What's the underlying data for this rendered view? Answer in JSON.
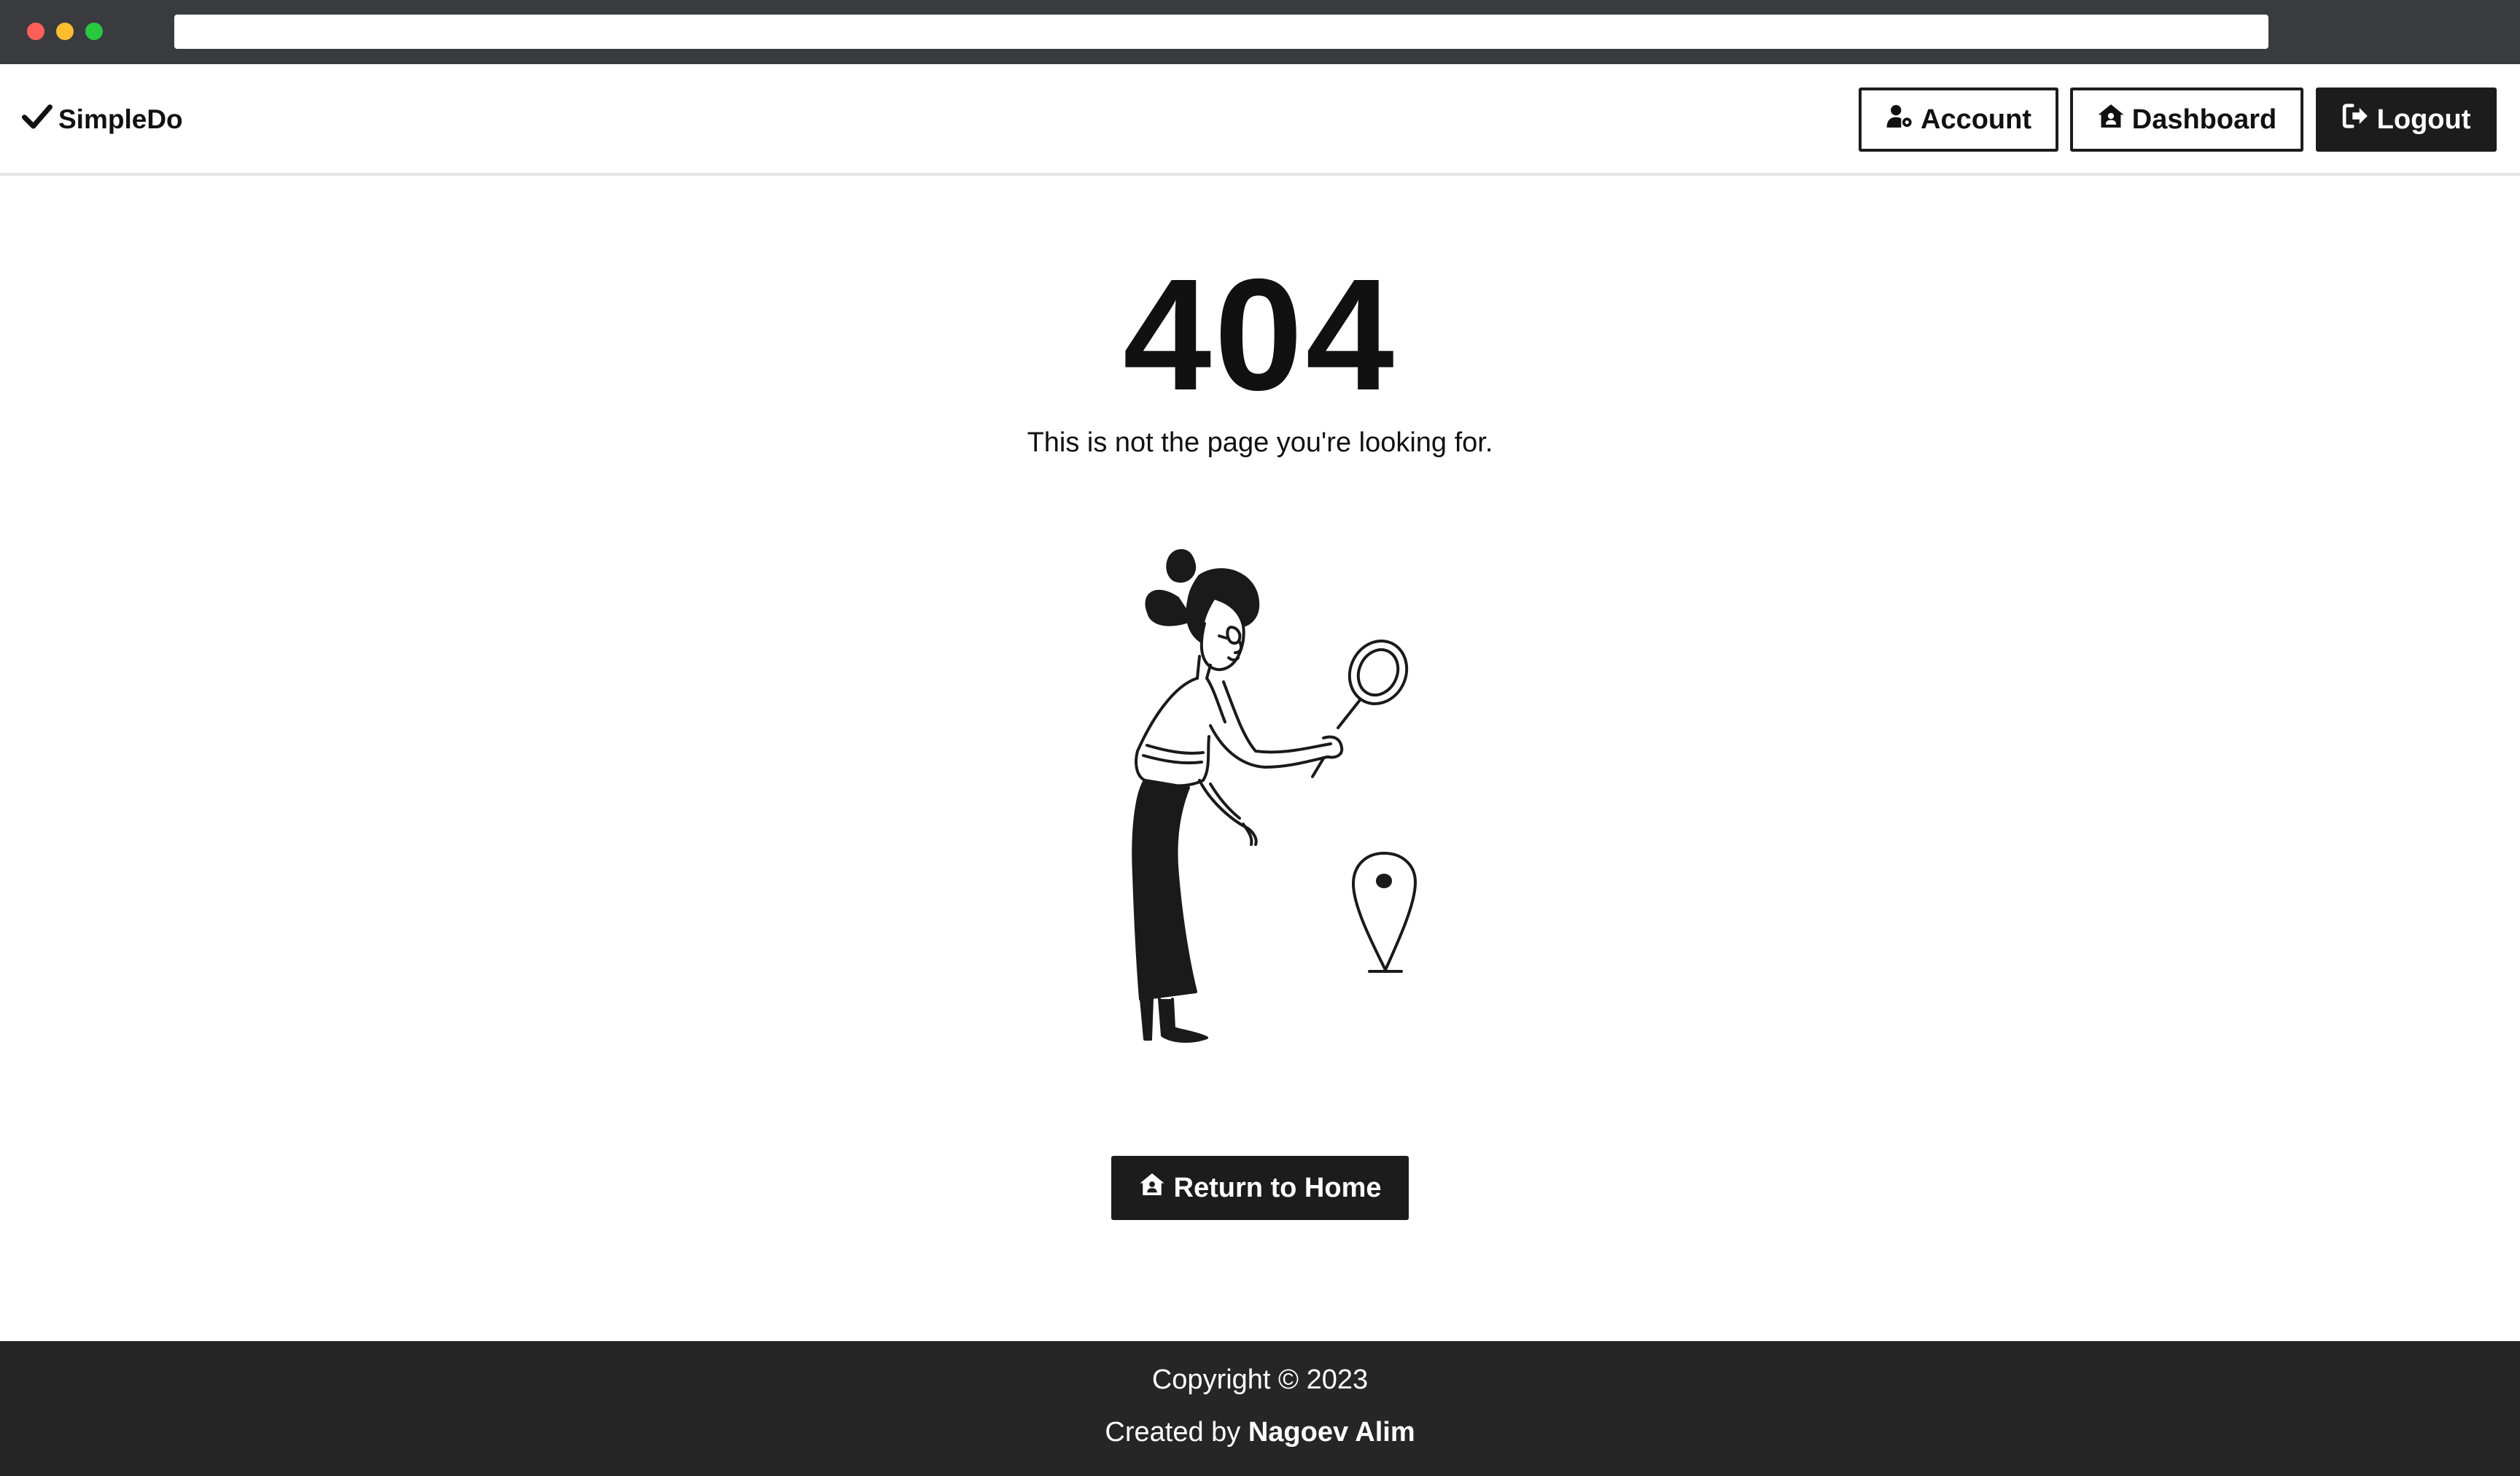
{
  "app": {
    "brand": "SimpleDo"
  },
  "navbar": {
    "account_label": "Account",
    "dashboard_label": "Dashboard",
    "logout_label": "Logout"
  },
  "error": {
    "code": "404",
    "message": "This is not the page you're looking for.",
    "illustration": "woman-with-magnifying-glass-and-location-pin"
  },
  "actions": {
    "home_label": "Return to Home"
  },
  "footer": {
    "copyright": "Copyright © 2023",
    "created_by_prefix": "Created by",
    "author": "Nagoev Alim"
  },
  "icons": {
    "brand": "check-icon",
    "account": "user-gear-icon",
    "dashboard": "house-user-icon",
    "logout": "logout-icon",
    "home": "house-user-icon"
  },
  "colors": {
    "primary": "#1c1c1c",
    "footer_bg": "#262626",
    "chrome_bg": "#3a3b3f",
    "background": "#ffffff"
  }
}
